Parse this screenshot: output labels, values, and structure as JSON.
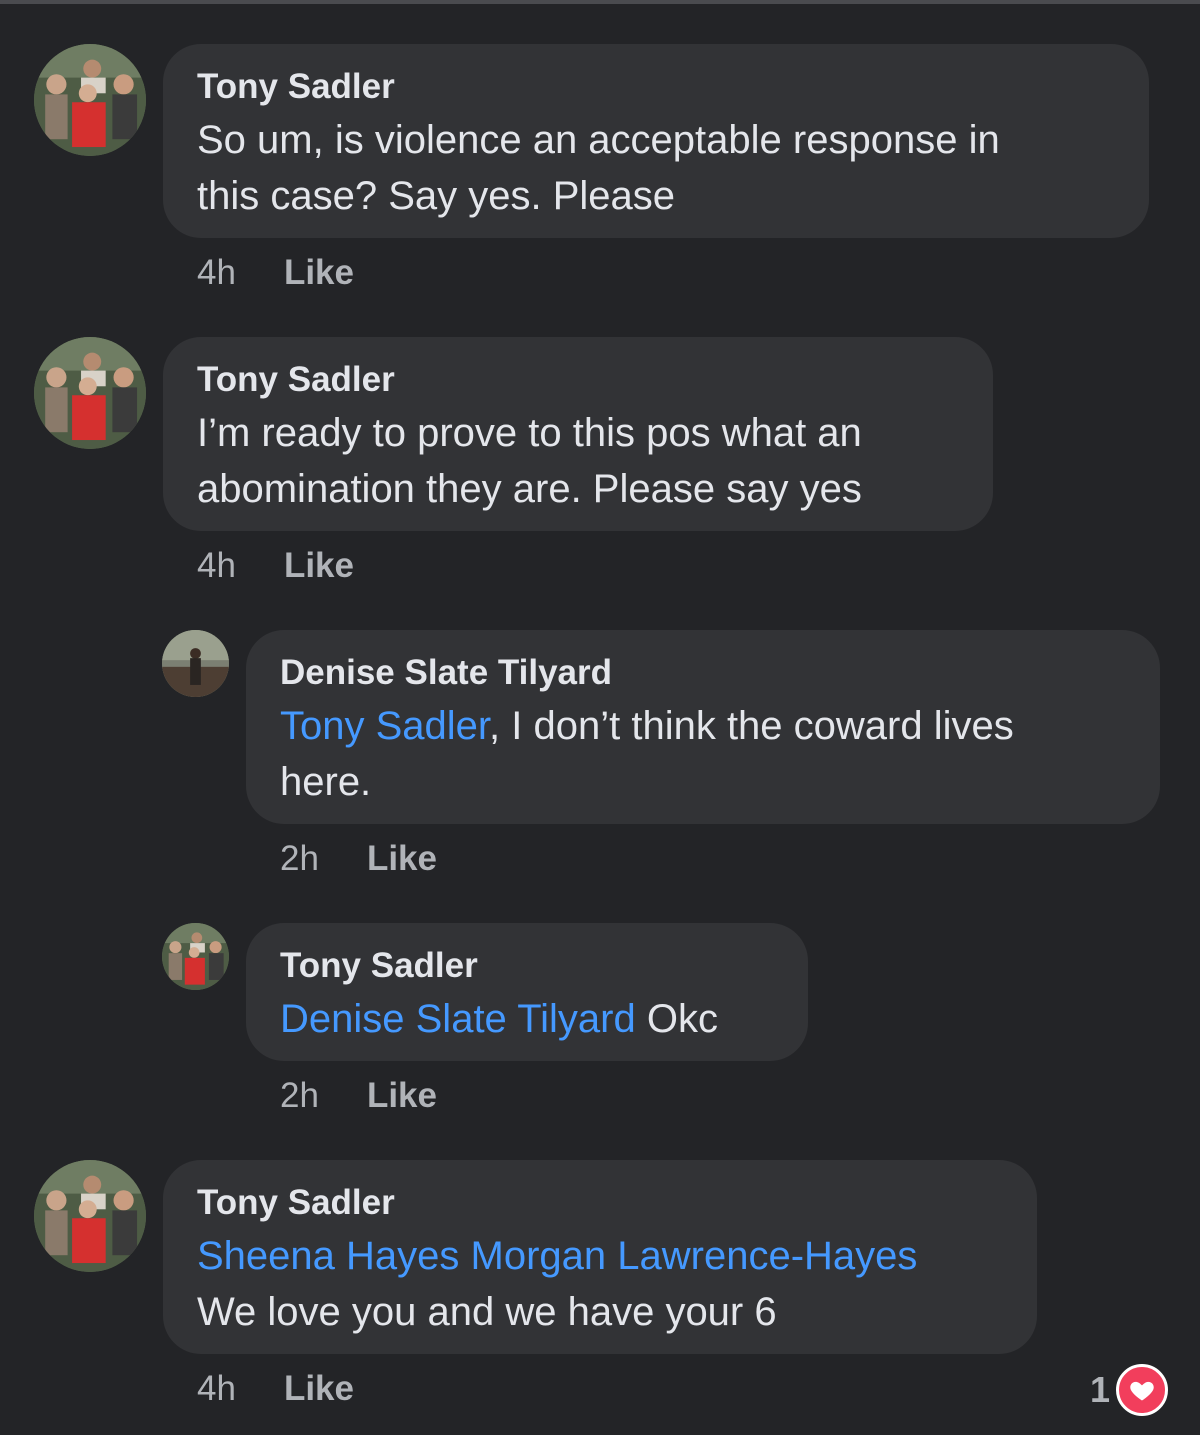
{
  "comments": [
    {
      "author": "Tony Sadler",
      "mention": "",
      "text_line1": "So um, is violence an  acceptable response in",
      "text_line2": "this case? Say yes. Please",
      "time": "4h",
      "like": "Like"
    },
    {
      "author": "Tony Sadler",
      "mention": "",
      "text_line1": "I’m ready to prove to this pos what an",
      "text_line2": "abomination they are. Please say yes",
      "time": "4h",
      "like": "Like"
    },
    {
      "author": "Denise Slate Tilyard",
      "mention": "Tony Sadler",
      "text_line1": ", I don’t think the coward lives",
      "text_line2": "here.",
      "time": "2h",
      "like": "Like"
    },
    {
      "author": "Tony Sadler",
      "mention": "Denise Slate Tilyard",
      "text_line1": " Okc",
      "text_line2": "",
      "time": "2h",
      "like": "Like"
    },
    {
      "author": "Tony Sadler",
      "mention": "Sheena Hayes Morgan Lawrence-Hayes",
      "text_line1": "",
      "text_line2": "We love you and we have your 6",
      "time": "4h",
      "like": "Like",
      "reaction_count": "1",
      "reaction_icon": "heart-icon"
    }
  ],
  "colors": {
    "background": "#232427",
    "bubble": "#323336",
    "mention": "#4599ff",
    "reaction_heart": "#f23e5c"
  }
}
